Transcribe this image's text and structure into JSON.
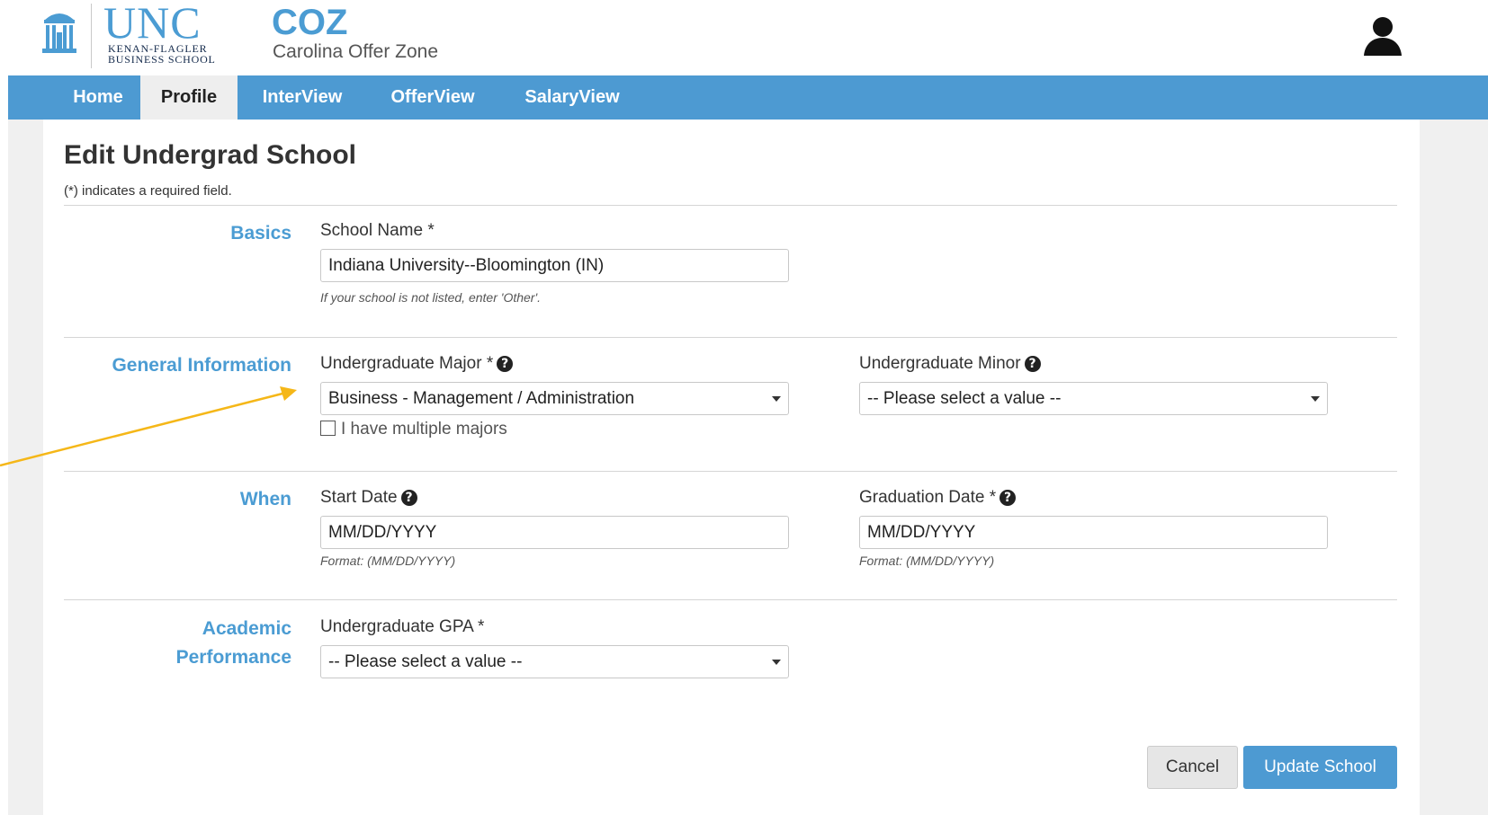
{
  "header": {
    "logo_unc": "UNC",
    "logo_line1": "KENAN-FLAGLER",
    "logo_line2": "BUSINESS SCHOOL",
    "app_title": "COZ",
    "app_subtitle": "Carolina Offer Zone",
    "user_icon": "user-icon"
  },
  "nav": {
    "items": [
      {
        "label": "Home"
      },
      {
        "label": "Profile",
        "active": true
      },
      {
        "label": "InterView"
      },
      {
        "label": "OfferView"
      },
      {
        "label": "SalaryView"
      }
    ]
  },
  "page": {
    "title": "Edit Undergrad School",
    "required_note": "(*) indicates a required field."
  },
  "sections": {
    "basics": {
      "label": "Basics",
      "school_name_label": "School Name *",
      "school_name_value": "Indiana University--Bloomington (IN)",
      "school_name_hint": "If your school is not listed, enter 'Other'."
    },
    "general": {
      "label": "General Information",
      "major_label": "Undergraduate Major *",
      "major_value": "Business - Management / Administration",
      "multiple_majors_label": "I have multiple majors",
      "multiple_majors_checked": false,
      "minor_label": "Undergraduate Minor",
      "minor_value": "-- Please select a value --"
    },
    "when": {
      "label": "When",
      "start_label": "Start Date",
      "start_placeholder": "MM/DD/YYYY",
      "start_hint": "Format: (MM/DD/YYYY)",
      "grad_label": "Graduation Date *",
      "grad_placeholder": "MM/DD/YYYY",
      "grad_hint": "Format: (MM/DD/YYYY)"
    },
    "academic": {
      "label_line1": "Academic",
      "label_line2": "Performance",
      "gpa_label": "Undergraduate GPA *",
      "gpa_value": "-- Please select a value --"
    }
  },
  "buttons": {
    "cancel": "Cancel",
    "update": "Update School"
  },
  "colors": {
    "brand_blue": "#4b9cd3",
    "nav_blue": "#4d9ad2",
    "annotation_arrow": "#f5b718"
  }
}
